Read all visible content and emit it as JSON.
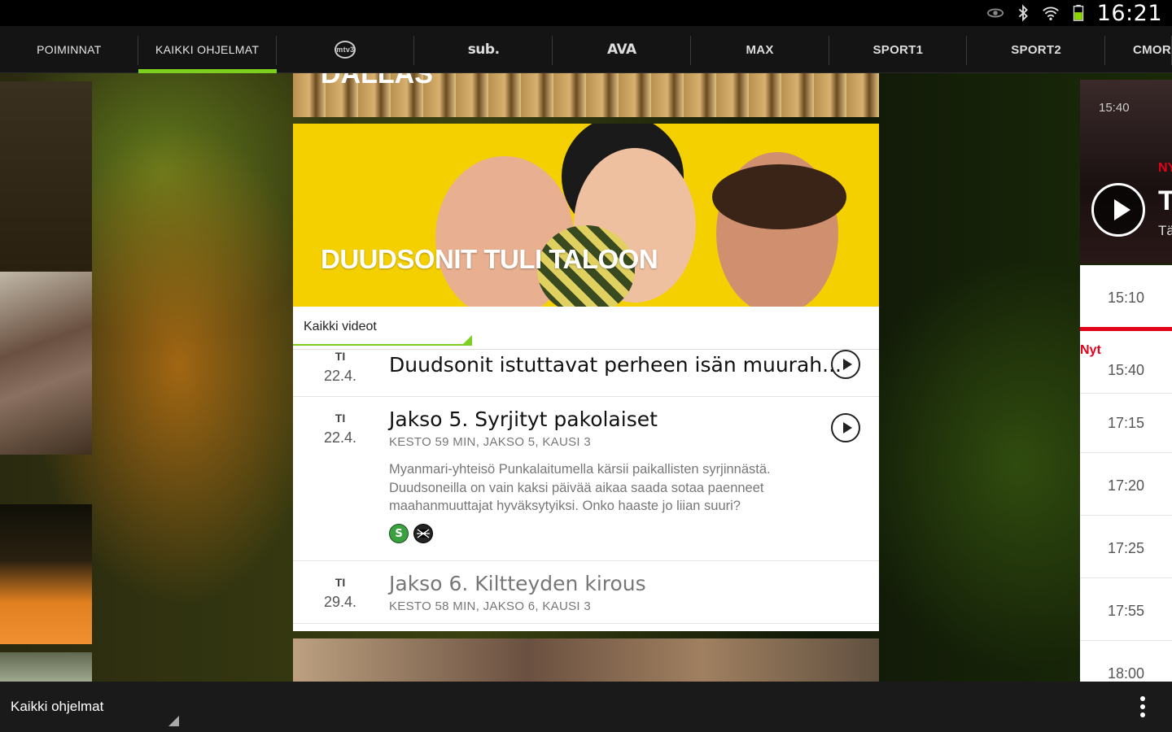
{
  "status_bar": {
    "clock": "16:21",
    "icons": [
      "eye-icon",
      "bluetooth-icon",
      "wifi-icon",
      "battery-icon"
    ]
  },
  "tabs": [
    {
      "label": "POIMINNAT",
      "kind": "text"
    },
    {
      "label": "KAIKKI OHJELMAT",
      "kind": "text",
      "active": true
    },
    {
      "label": "mtv3",
      "kind": "logo"
    },
    {
      "label": "sub.",
      "kind": "logo"
    },
    {
      "label": "AVA",
      "kind": "logo"
    },
    {
      "label": "MAX",
      "kind": "logo"
    },
    {
      "label": "SPORT1",
      "kind": "logo"
    },
    {
      "label": "SPORT2",
      "kind": "logo"
    },
    {
      "label": "CMORE",
      "kind": "logo"
    }
  ],
  "top_card": {
    "title": "DALLAS"
  },
  "show": {
    "title": "DUUDSONIT TULI TALOON",
    "filter": "Kaikki videot",
    "episodes": [
      {
        "day": "TI",
        "date": "22.4.",
        "title": "Duudsonit istuttavat perheen isän muurah...",
        "has_play": true
      },
      {
        "day": "TI",
        "date": "22.4.",
        "title": "Jakso 5. Syrjityt pakolaiset",
        "meta": "KESTO 59 MIN, JAKSO 5, KAUSI 3",
        "description": "Myanmari-yhteisö Punkalaitumella kärsii paikallisten syrjinnästä. Duudsoneilla on vain kaksi päivää aikaa saada sotaa paenneet maahanmuuttajat hyväksytyiksi. Onko haaste jo liian suuri?",
        "has_play": true,
        "badges": [
          "S",
          "K"
        ]
      },
      {
        "day": "TI",
        "date": "29.4.",
        "title": "Jakso 6. Kiltteyden kirous",
        "meta": "KESTO 58 MIN, JAKSO 6, KAUSI 3",
        "has_play": false
      }
    ]
  },
  "now_playing": {
    "time": "15:40",
    "label": "NY",
    "big": "T",
    "sub": "Tä"
  },
  "schedule": {
    "items": [
      "15:10",
      "15:40",
      "17:15",
      "17:20",
      "17:25",
      "17:55",
      "18:00"
    ],
    "now_label": "Nyt"
  },
  "bottom_bar": {
    "label": "Kaikki ohjelmat"
  },
  "colors": {
    "accent": "#7ccf1e",
    "live": "#e2001a",
    "hero_bg": "#f5d000"
  }
}
